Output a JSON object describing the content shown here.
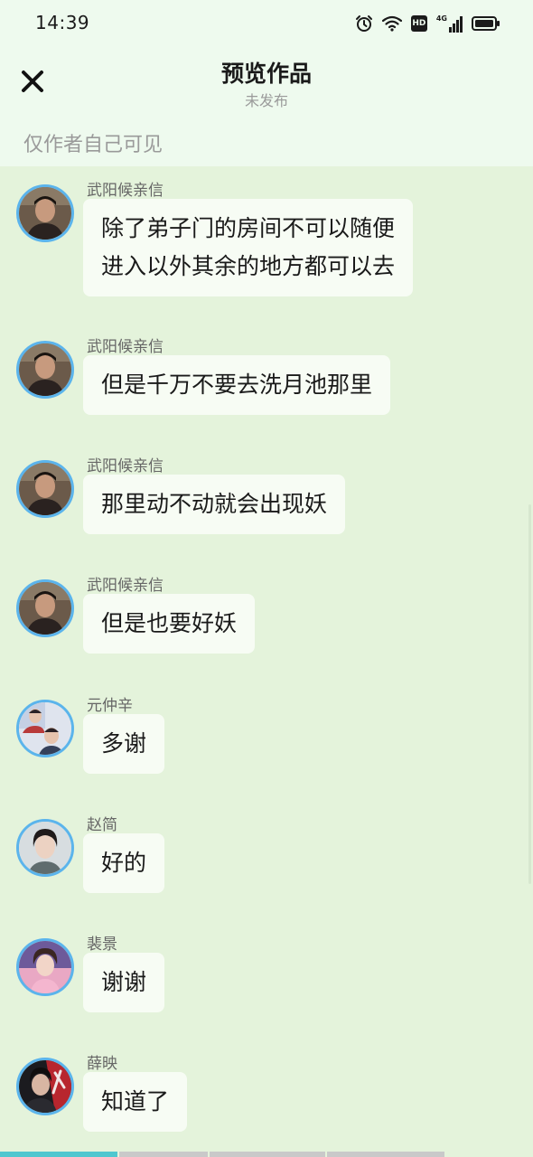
{
  "status_bar": {
    "time": "14:39",
    "icons": [
      "alarm-icon",
      "wifi-icon",
      "hd-icon",
      "4g-signal-icon",
      "battery-icon"
    ],
    "hd_label": "HD",
    "network_label": "4G"
  },
  "header": {
    "title": "预览作品",
    "subtitle": "未发布",
    "visibility_note": "仅作者自己可见",
    "close_icon": "close-icon"
  },
  "colors": {
    "background": "#e4f3db",
    "header_background": "#eefaee",
    "bubble": "#f7fcf4",
    "avatar_ring": "#5bb4ec",
    "progress_active": "#4fc7cf"
  },
  "messages": [
    {
      "sender": "武阳候亲信",
      "text": "除了弟子门的房间不可以随便\n进入以外其余的地方都可以去",
      "avatar": "avatar-wuyang"
    },
    {
      "sender": "武阳候亲信",
      "text": "但是千万不要去洗月池那里",
      "avatar": "avatar-wuyang"
    },
    {
      "sender": "武阳候亲信",
      "text": "那里动不动就会出现妖",
      "avatar": "avatar-wuyang"
    },
    {
      "sender": "武阳候亲信",
      "text": "但是也要好妖",
      "avatar": "avatar-wuyang"
    },
    {
      "sender": "元仲辛",
      "text": "多谢",
      "avatar": "avatar-yuanzhongxin"
    },
    {
      "sender": "赵简",
      "text": "好的",
      "avatar": "avatar-zhaojian"
    },
    {
      "sender": "裴景",
      "text": "谢谢",
      "avatar": "avatar-peijing"
    },
    {
      "sender": "薛映",
      "text": "知道了",
      "avatar": "avatar-xueying"
    }
  ],
  "progress": {
    "segments": 4,
    "first_segment_filled_fraction": 0.25
  }
}
